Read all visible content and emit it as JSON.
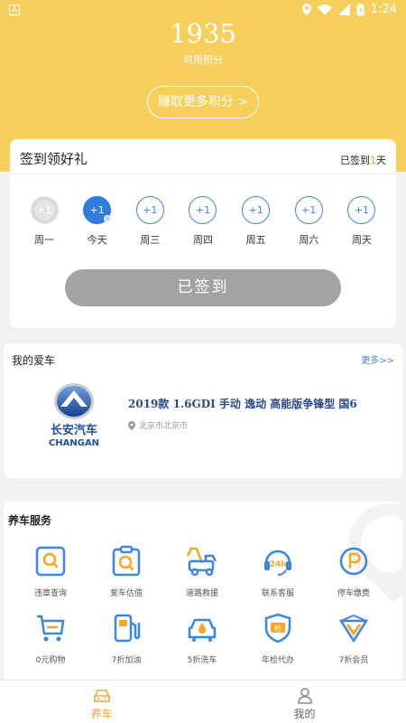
{
  "status_bar": {
    "time": "1:24",
    "left_icon": "A"
  },
  "header": {
    "points": "1935",
    "points_label": "可用积分",
    "earn_button": "赚取更多积分 >"
  },
  "signin": {
    "title": "签到领好礼",
    "count_prefix": "已签到",
    "count_num": "1",
    "count_suffix": "天",
    "days": [
      {
        "label": "周一",
        "reward": "+1",
        "state": "past"
      },
      {
        "label": "今天",
        "reward": "+1",
        "state": "today"
      },
      {
        "label": "周三",
        "reward": "+1",
        "state": "future"
      },
      {
        "label": "周四",
        "reward": "+1",
        "state": "future"
      },
      {
        "label": "周五",
        "reward": "+1",
        "state": "future"
      },
      {
        "label": "周六",
        "reward": "+1",
        "state": "future"
      },
      {
        "label": "周天",
        "reward": "+1",
        "state": "future"
      }
    ],
    "button": "已签到"
  },
  "my_car": {
    "title": "我的爱车",
    "more": "更多>>",
    "brand_cn": "长安汽车",
    "brand_en": "CHANGAN",
    "model": "2019款 1.6GDI 手动 逸动 高能版争锋型 国6",
    "location": "北京市北京市"
  },
  "services": {
    "title": "养车服务",
    "items": [
      {
        "label": "违章查询",
        "icon": "violation-search-icon"
      },
      {
        "label": "爱车估值",
        "icon": "car-valuation-icon"
      },
      {
        "label": "道路救援",
        "icon": "road-rescue-icon"
      },
      {
        "label": "联系客服",
        "icon": "customer-service-icon"
      },
      {
        "label": "停车缴费",
        "icon": "parking-fee-icon"
      },
      {
        "label": "0元购物",
        "icon": "shopping-cart-icon"
      },
      {
        "label": "7折加油",
        "icon": "fuel-pump-icon"
      },
      {
        "label": "5折洗车",
        "icon": "car-wash-icon"
      },
      {
        "label": "年检代办",
        "icon": "inspection-shield-icon"
      },
      {
        "label": "7折会员",
        "icon": "vip-icon"
      }
    ]
  },
  "tabbar": {
    "tabs": [
      {
        "label": "养车",
        "icon": "car-icon",
        "active": true
      },
      {
        "label": "我的",
        "icon": "user-icon",
        "active": false
      }
    ]
  },
  "colors": {
    "header_yellow": "#f7cf5c",
    "accent_orange": "#f5a623",
    "accent_blue": "#3a86e6",
    "signed_gray": "#a3a3a3"
  }
}
